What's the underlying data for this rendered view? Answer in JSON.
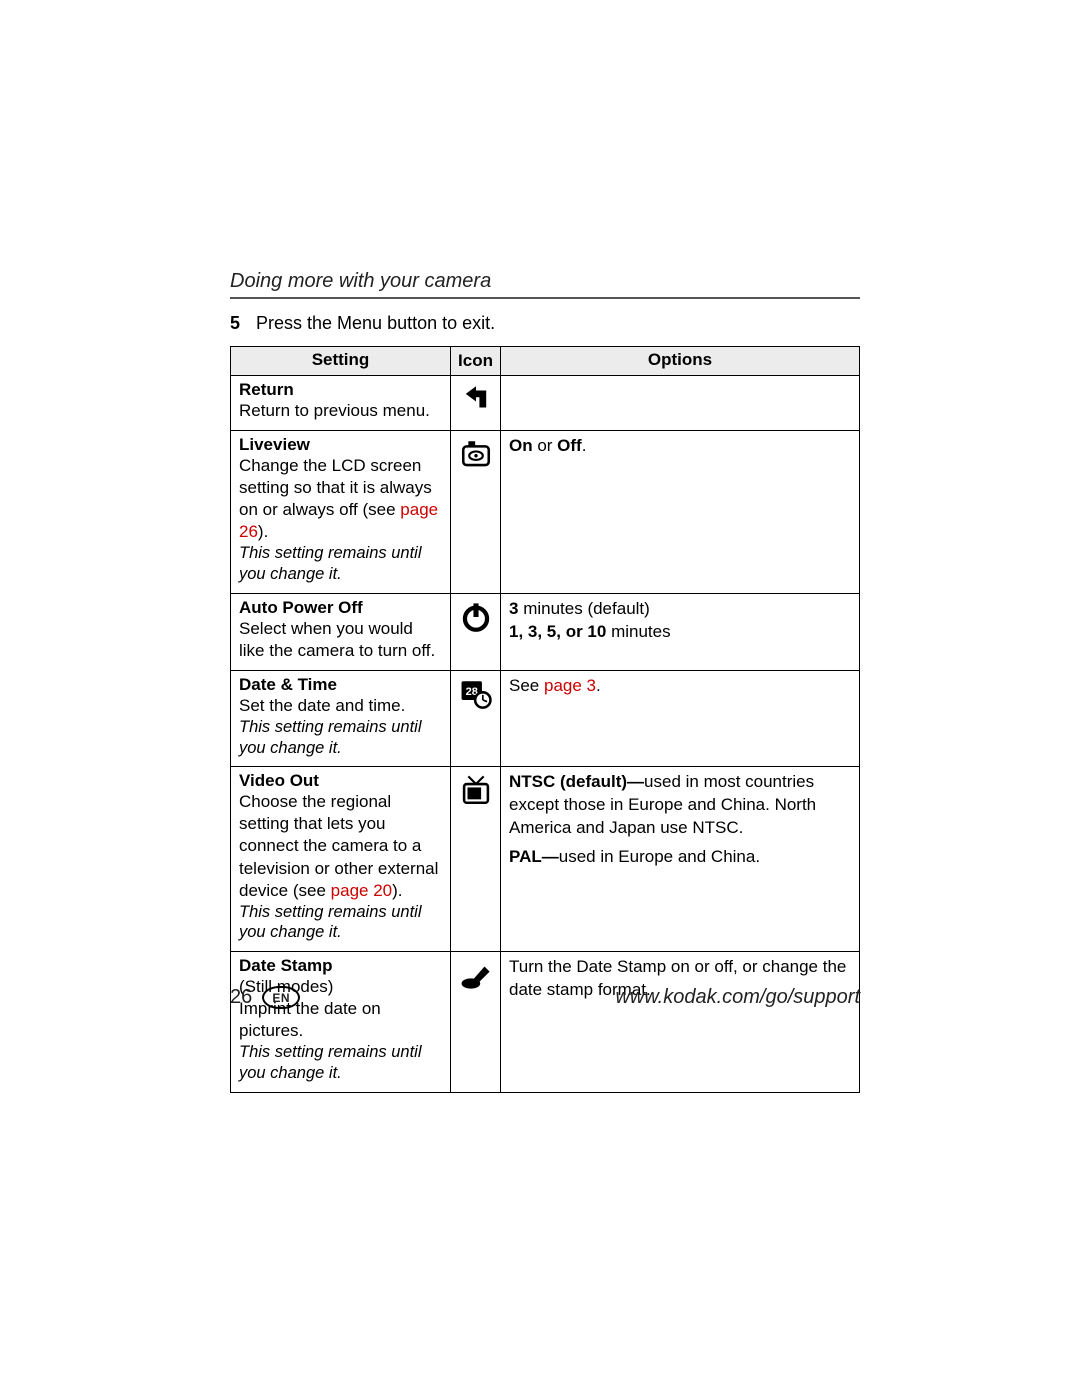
{
  "header": {
    "section_title": "Doing more with your camera"
  },
  "step": {
    "number": "5",
    "text": "Press the Menu button to exit."
  },
  "table": {
    "headers": {
      "setting": "Setting",
      "icon": "Icon",
      "options": "Options"
    },
    "rows": {
      "return": {
        "title": "Return",
        "desc": "Return to previous menu."
      },
      "liveview": {
        "title": "Liveview",
        "desc_pre": "Change the LCD screen setting so that it is always on or always off (see ",
        "desc_link": "page 26",
        "desc_post": ").",
        "persist": "This setting remains until you change it.",
        "opt_on": "On",
        "opt_or": " or ",
        "opt_off": "Off",
        "opt_end": "."
      },
      "autopower": {
        "title": "Auto Power Off",
        "desc": "Select when you would like the camera to turn off.",
        "opt_default_num": "3",
        "opt_default_text": " minutes (default)",
        "opt_list_bold": "1, 3, 5, or 10",
        "opt_list_text": " minutes"
      },
      "datetime": {
        "title": "Date & Time",
        "desc": "Set the date and time.",
        "persist": "This setting remains until you change it.",
        "opt_pre": "See ",
        "opt_link": "page 3",
        "opt_post": "."
      },
      "videoout": {
        "title": "Video Out",
        "desc_pre": "Choose the regional setting that lets you connect the camera to a television or other external device (see ",
        "desc_link": "page 20",
        "desc_post": ").",
        "persist": "This setting remains until you change it.",
        "ntsc_bold": "NTSC (default)—",
        "ntsc_text": "used in most countries except those in Europe and China. North America and Japan use NTSC.",
        "pal_bold": "PAL—",
        "pal_text": "used in Europe and China."
      },
      "datestamp": {
        "title": "Date Stamp",
        "subtitle": "(Still modes)",
        "desc": "Imprint the date on pictures.",
        "persist": "This setting remains until you change it.",
        "opt": "Turn the Date Stamp on or off, or change the date stamp format."
      }
    }
  },
  "footer": {
    "page": "26",
    "lang": "EN",
    "url": "www.kodak.com/go/support"
  }
}
